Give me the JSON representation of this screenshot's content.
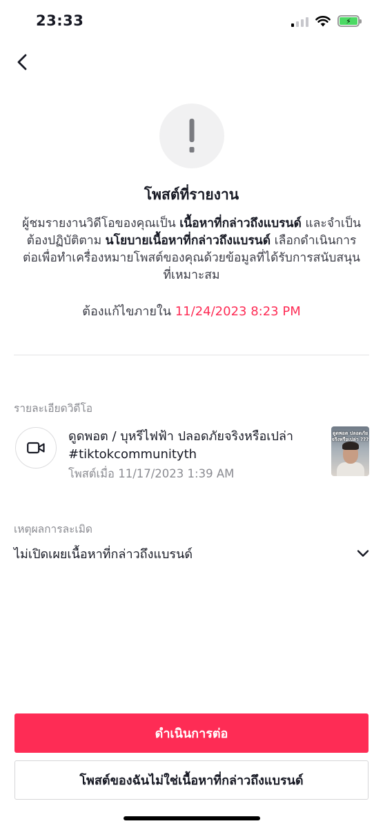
{
  "status_bar": {
    "time": "23:33",
    "icons": [
      "cellular-signal-icon",
      "wifi-icon",
      "battery-charging-icon"
    ],
    "battery_color": "#4cd964"
  },
  "header": {
    "back_icon": "chevron-left-icon"
  },
  "notice": {
    "icon": "exclamation-icon",
    "title": "โพสต์ที่รายงาน",
    "desc_part1": "ผู้ชมรายงานวิดีโอของคุณเป็น ",
    "desc_bold1": "เนื้อหาที่กล่าวถึงแบรนด์",
    "desc_part2": " และจำเป็นต้องปฏิบัติตาม ",
    "desc_bold2": "นโยบายเนื้อหาที่กล่าวถึงแบรนด์",
    "desc_part3": " เลือกดำเนินการต่อเพื่อทำเครื่องหมายโพสต์ของคุณด้วยข้อมูลที่ได้รับการสนับสนุนที่เหมาะสม",
    "deadline_label": "ต้องแก้ไขภายใน ",
    "deadline_date": "11/24/2023 8:23 PM",
    "deadline_color": "#fe2c55"
  },
  "video_details": {
    "section_label": "รายละเอียดวิดีโอ",
    "icon": "video-camera-icon",
    "title": "ดูดพอต / บุหรีไฟฟ้า ปลอดภัยจริงหรือเปล่า #tiktokcommunityth",
    "posted": "โพสต์เมื่อ 11/17/2023 1:39 AM",
    "thumbnail_caption": "ดูดพอต ปลอดภัย จริงหรือเปล่า ???"
  },
  "violation": {
    "section_label": "เหตุผลการละเมิด",
    "reason": "ไม่เปิดเผยเนื้อหาที่กล่าวถึงแบรนด์",
    "icon": "chevron-down-icon"
  },
  "actions": {
    "primary_label": "ดำเนินการต่อ",
    "primary_color": "#fe2c55",
    "secondary_label": "โพสต์ของฉันไม่ใช่เนื้อหาที่กล่าวถึงแบรนด์"
  }
}
